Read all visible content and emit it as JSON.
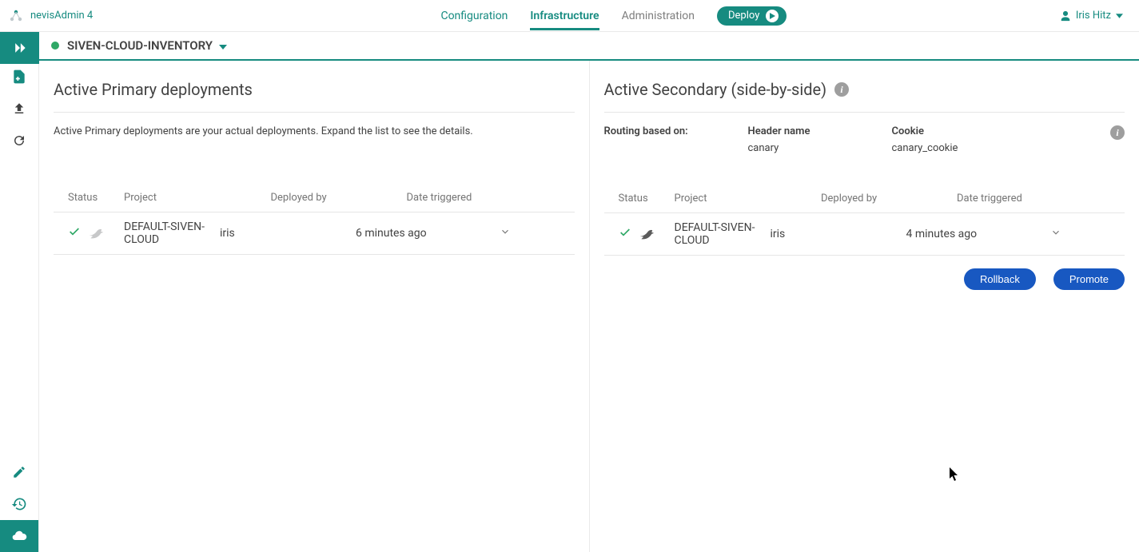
{
  "header": {
    "app_name": "nevisAdmin 4",
    "nav": {
      "configuration": "Configuration",
      "infrastructure": "Infrastructure",
      "administration": "Administration"
    },
    "deploy_label": "Deploy",
    "user_name": "Iris Hitz"
  },
  "sub_header": {
    "inventory_name": "SIVEN-CLOUD-INVENTORY"
  },
  "primary": {
    "title": "Active Primary deployments",
    "description": "Active Primary deployments are your actual deployments. Expand the list to see the details.",
    "columns": {
      "status": "Status",
      "project": "Project",
      "deployed_by": "Deployed by",
      "date": "Date triggered"
    },
    "row": {
      "project": "DEFAULT-SIVEN-CLOUD",
      "deployed_by": "iris",
      "date": "6 minutes ago"
    }
  },
  "secondary": {
    "title": "Active Secondary (side-by-side)",
    "routing_label": "Routing based on:",
    "header_name_label": "Header name",
    "header_name_value": "canary",
    "cookie_label": "Cookie",
    "cookie_value": "canary_cookie",
    "columns": {
      "status": "Status",
      "project": "Project",
      "deployed_by": "Deployed by",
      "date": "Date triggered"
    },
    "row": {
      "project": "DEFAULT-SIVEN-CLOUD",
      "deployed_by": "iris",
      "date": "4 minutes ago"
    },
    "rollback_label": "Rollback",
    "promote_label": "Promote"
  }
}
